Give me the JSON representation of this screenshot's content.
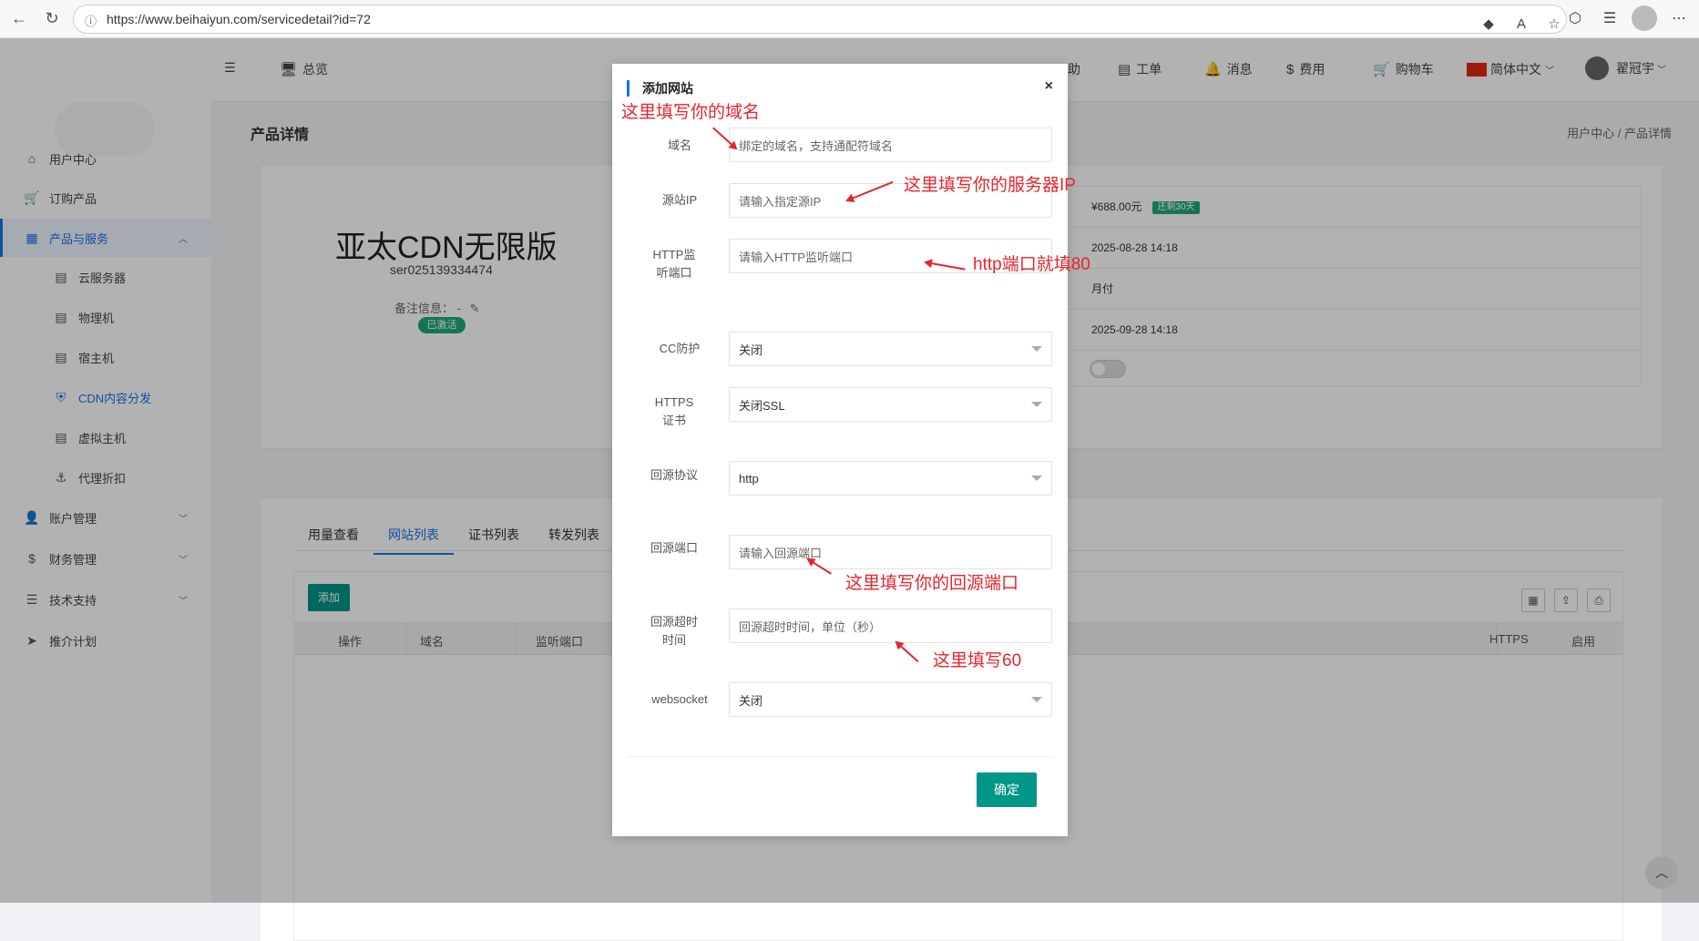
{
  "browser": {
    "url": "https://www.beihaiyun.com/servicedetail?id=72"
  },
  "topnav": {
    "overview": "总览",
    "help": "助",
    "tickets": "工单",
    "messages": "消息",
    "fees": "费用",
    "cart": "购物车",
    "language": "简体中文",
    "username": "翟冠宇"
  },
  "sidebar": {
    "items": [
      {
        "label": "用户中心",
        "icon": "home-icon"
      },
      {
        "label": "订购产品",
        "icon": "cart-icon"
      },
      {
        "label": "产品与服务",
        "icon": "grid-icon"
      },
      {
        "label": "云服务器",
        "icon": "doc-icon"
      },
      {
        "label": "物理机",
        "icon": "doc-icon"
      },
      {
        "label": "宿主机",
        "icon": "doc-icon"
      },
      {
        "label": "CDN内容分发",
        "icon": "shield-icon"
      },
      {
        "label": "虚拟主机",
        "icon": "doc-icon"
      },
      {
        "label": "代理折扣",
        "icon": "anchor-icon"
      },
      {
        "label": "账户管理",
        "icon": "user-icon"
      },
      {
        "label": "财务管理",
        "icon": "dollar-icon"
      },
      {
        "label": "技术支持",
        "icon": "list-icon"
      },
      {
        "label": "推介计划",
        "icon": "send-icon"
      }
    ]
  },
  "page": {
    "title": "产品详情",
    "breadcrumb": "用户中心  /  产品详情"
  },
  "product": {
    "name": "亚太CDN无限版",
    "id": "ser025139334474",
    "note": "备注信息：  -",
    "status": "已激活",
    "price": "¥688.00元",
    "renew_badge": "还剩30天",
    "created": "2025-08-28 14:18",
    "billing": "月付",
    "expires": "2025-09-28 14:18"
  },
  "tabs": [
    "用量查看",
    "网站列表",
    "证书列表",
    "转发列表"
  ],
  "table": {
    "add_label": "添加",
    "columns": [
      "操作",
      "域名",
      "监听端口",
      "HTTPS",
      "启用"
    ]
  },
  "modal": {
    "title": "添加网站",
    "fields": [
      {
        "label": "域名",
        "placeholder": "绑定的域名，支持通配符域名"
      },
      {
        "label": "源站IP",
        "placeholder": "请输入指定源IP"
      },
      {
        "label": "HTTP监听端口",
        "placeholder": "请输入HTTP监听端口"
      },
      {
        "label": "CC防护",
        "value": "关闭"
      },
      {
        "label": "HTTPS证书",
        "value": "关闭SSL"
      },
      {
        "label": "回源协议",
        "value": "http"
      },
      {
        "label": "回源端口",
        "placeholder": "请输入回源端口"
      },
      {
        "label": "回源超时时间",
        "placeholder": "回源超时时间，单位（秒）"
      },
      {
        "label": "websocket",
        "value": "关闭"
      }
    ],
    "submit": "确定"
  },
  "annotations": [
    "这里填写你的域名",
    "这里填写你的服务器IP",
    "http端口就填80",
    "这里填写你的回源端口",
    "这里填写60"
  ],
  "colors": {
    "accent": "#1a73e8",
    "primary_button": "#009688",
    "annotation": "#e8242c",
    "badge": "#1ea876"
  }
}
